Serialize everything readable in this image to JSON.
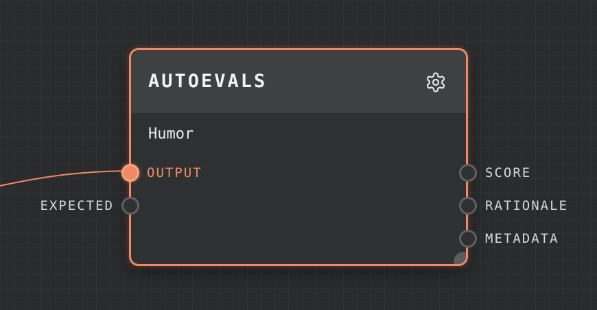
{
  "node": {
    "title": "AUTOEVALS",
    "subtitle": "Humor",
    "settings_icon": "gear-icon"
  },
  "inputs": [
    {
      "label": "OUTPUT",
      "connected": true
    },
    {
      "label": "EXPECTED",
      "connected": false
    }
  ],
  "outputs": [
    {
      "label": "SCORE"
    },
    {
      "label": "RATIONALE"
    },
    {
      "label": "METADATA"
    }
  ],
  "colors": {
    "accent": "#f08a66",
    "background": "#2a2b2d",
    "node_body": "#2f3032",
    "node_header": "#3f4041",
    "port_idle": "#5f6062"
  }
}
